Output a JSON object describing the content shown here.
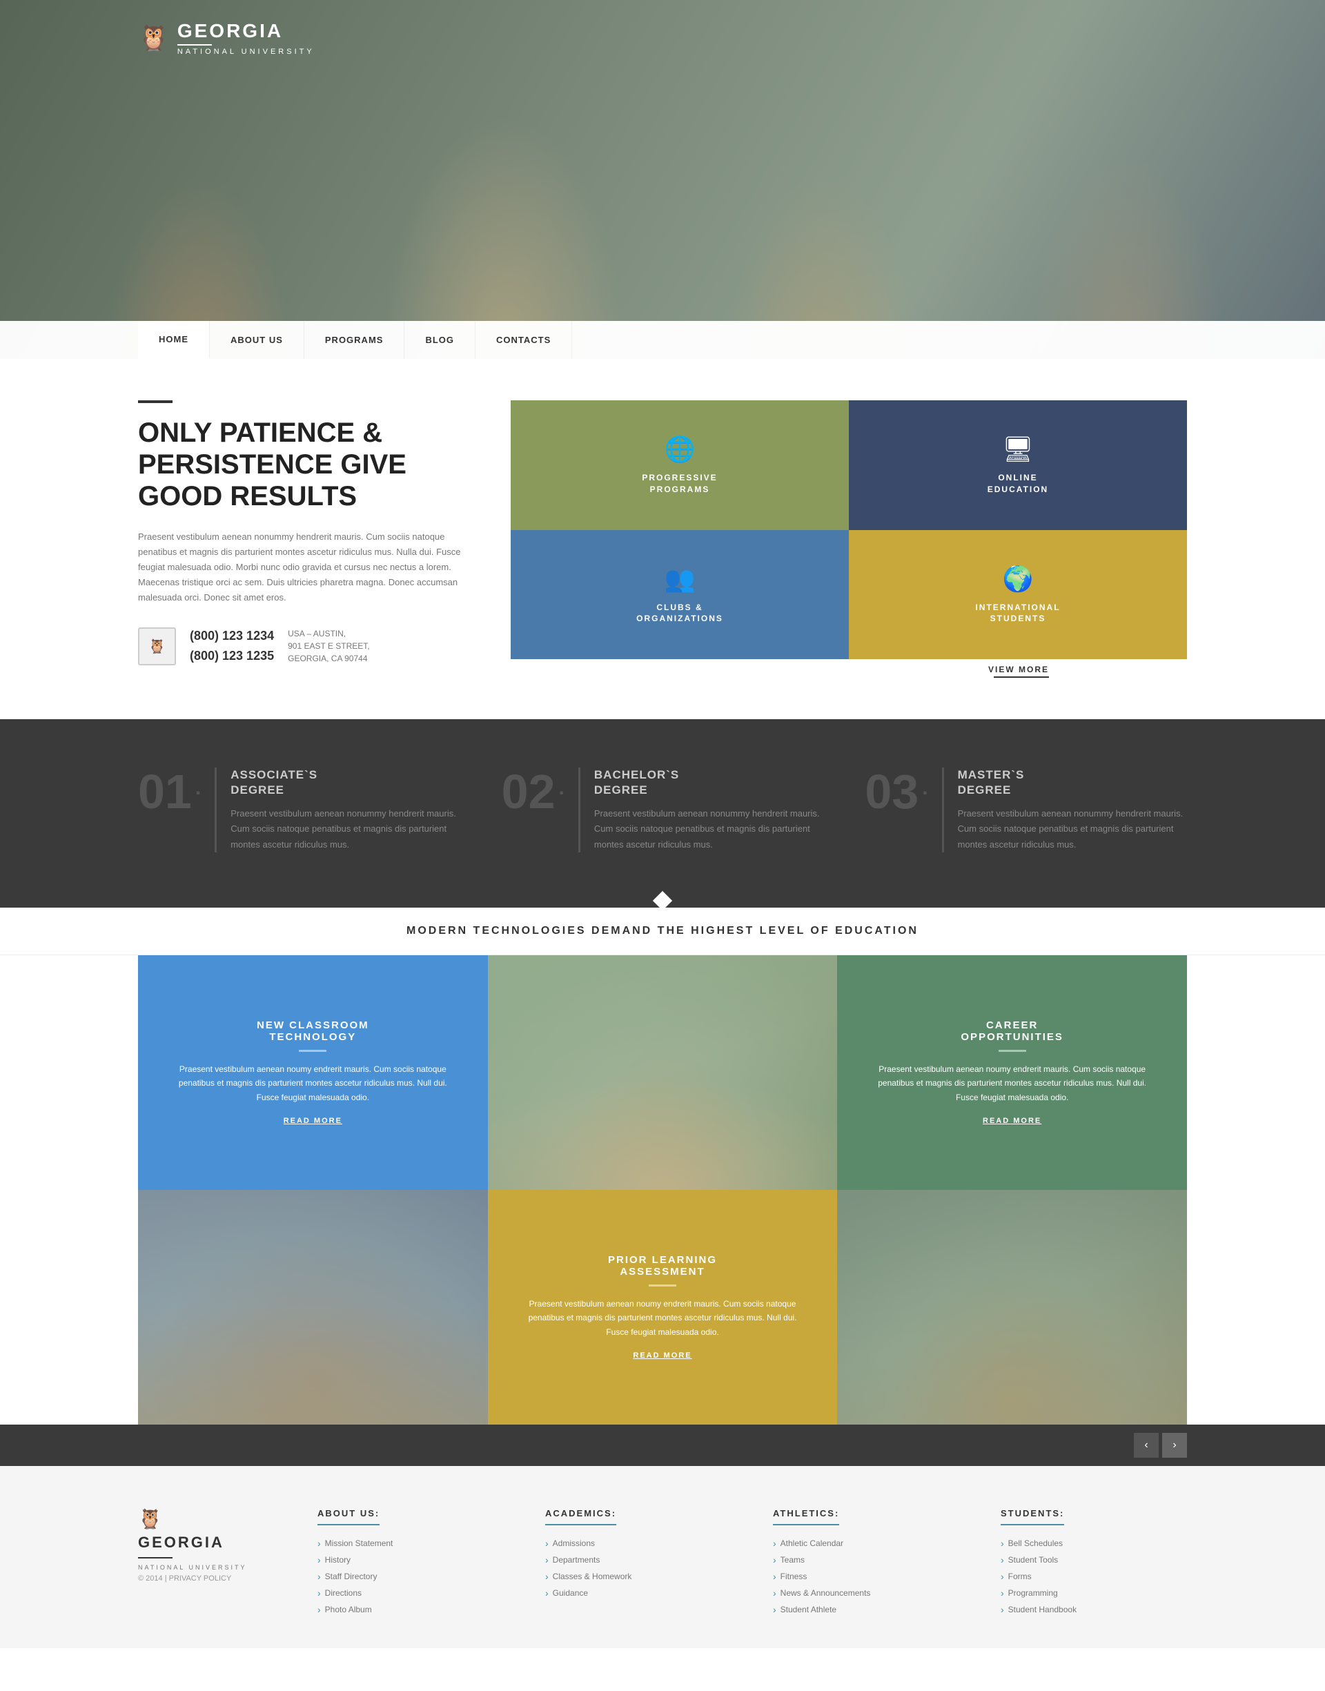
{
  "site": {
    "name": "GEORGIA",
    "subtitle": "NATIONAL UNIVERSITY",
    "privacy": "© 2014 | PRIVACY POLICY"
  },
  "nav": {
    "items": [
      {
        "label": "HOME",
        "active": true
      },
      {
        "label": "ABOUT US",
        "active": false
      },
      {
        "label": "PROGRAMS",
        "active": false
      },
      {
        "label": "BLOG",
        "active": false
      },
      {
        "label": "CONTACTS",
        "active": false
      }
    ]
  },
  "hero": {
    "heading_line1": "ONLY PATIENCE &",
    "heading_line2": "PERSISTENCE GIVE",
    "heading_line3": "GOOD RESULTS",
    "body_text": "Praesent vestibulum aenean nonummy hendrerit mauris. Cum sociis natoque penatibus et magnis dis parturient montes ascetur ridiculus mus. Nulla dui. Fusce feugiat malesuada odio. Morbi nunc odio gravida et cursus nec nectus a lorem. Maecenas tristique orci ac sem. Duis ultricies pharetra magna. Donec accumsan malesuada orci. Donec sit amet eros.",
    "phone1": "(800) 123 1234",
    "phone2": "(800) 123 1235",
    "address_line1": "USA – AUSTIN,",
    "address_line2": "901 EAST E STREET,",
    "address_line3": "GEORGIA, CA 90744"
  },
  "tiles": [
    {
      "label": "PROGRESSIVE\nPROGRAMS",
      "icon": "🌐",
      "color": "olive"
    },
    {
      "label": "ONLINE\nEDUCATION",
      "icon": "🖥",
      "color": "navy"
    },
    {
      "label": "CLUBS &\nORGANIZATIONS",
      "icon": "👥",
      "color": "blue"
    },
    {
      "label": "INTERNATIONAL\nSTUDENTS",
      "icon": "🌍",
      "color": "gold"
    }
  ],
  "view_more": "VIEW MORE",
  "degrees": [
    {
      "number": "01",
      "title": "ASSOCIATE`S\nDEGREE",
      "text": "Praesent vestibulum aenean nonummy hendrerit mauris. Cum sociis natoque penatibus et magnis dis parturient montes ascetur ridiculus mus."
    },
    {
      "number": "02",
      "title": "BACHELOR`S\nDEGREE",
      "text": "Praesent vestibulum aenean nonummy hendrerit mauris. Cum sociis natoque penatibus et magnis dis parturient montes ascetur ridiculus mus."
    },
    {
      "number": "03",
      "title": "MASTER`S\nDEGREE",
      "text": "Praesent vestibulum aenean nonummy hendrerit mauris. Cum sociis natoque penatibus et magnis dis parturient montes ascetur ridiculus mus."
    }
  ],
  "tech_banner": {
    "heading": "MODERN TECHNOLOGIES DEMAND THE HIGHEST LEVEL OF EDUCATION",
    "cards": [
      {
        "title": "NEW CLASSROOM TECHNOLOGY",
        "text": "Praesent vestibulum aenean noumy endrerit mauris. Cum sociis natoque penatibus et magnis dis parturient montes ascetur ridiculus mus. Null dui. Fusce feugiat malesuada odio.",
        "read_more": "READ MORE",
        "type": "blue"
      },
      {
        "title": "CAREER OPPORTUNITIES",
        "text": "Praesent vestibulum aenean noumy endrerit mauris. Cum sociis natoque penatibus et magnis dis parturient montes ascetur ridiculus mus. Null dui. Fusce feugiat malesuada odio.",
        "read_more": "READ MORE",
        "type": "green"
      },
      {
        "title": "PRIOR LEARNING ASSESSMENT",
        "text": "Praesent vestibulum aenean noumy endrerit mauris. Cum sociis natoque penatibus et magnis dis parturient montes ascetur ridiculus mus. Null dui. Fusce feugiat malesuada odio.",
        "read_more": "READ MORE",
        "type": "gold"
      }
    ]
  },
  "footer": {
    "about_us": {
      "title": "ABOUT US:",
      "links": [
        "Mission Statement",
        "History",
        "Staff Directory",
        "Directions",
        "Photo Album"
      ]
    },
    "academics": {
      "title": "ACADEMICS:",
      "links": [
        "Admissions",
        "Departments",
        "Classes & Homework",
        "Guidance"
      ]
    },
    "athletics": {
      "title": "ATHLETICS:",
      "links": [
        "Athletic Calendar",
        "Teams",
        "Fitness",
        "News & Announcements",
        "Student Athlete"
      ]
    },
    "students": {
      "title": "STUDENTS:",
      "links": [
        "Bell Schedules",
        "Student Tools",
        "Forms",
        "Programming",
        "Student Handbook"
      ]
    }
  }
}
